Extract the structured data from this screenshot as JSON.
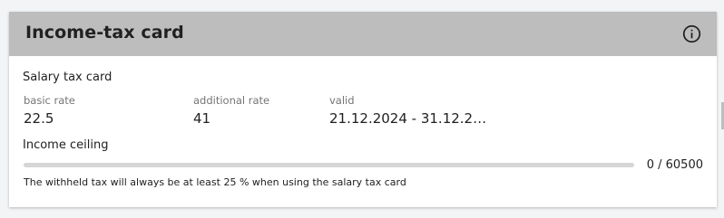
{
  "card": {
    "title": "Income-tax card",
    "info_icon": "info-circle-icon",
    "section_title": "Salary tax card",
    "fields": [
      {
        "label": "basic rate",
        "value": "22.5"
      },
      {
        "label": "additional rate",
        "value": "41"
      },
      {
        "label": "valid",
        "value": "21.12.2024 - 31.12.2…"
      }
    ],
    "ceiling": {
      "title": "Income ceiling",
      "current": 0,
      "max": 60500,
      "progress_text": "0 / 60500",
      "fraction": 0
    },
    "footnote": "The withheld tax will always be at least 25 % when using the salary tax card"
  },
  "colors": {
    "header_bg": "#bdbdbd",
    "track": "#d6d6d6",
    "fill": "#1976d2"
  }
}
